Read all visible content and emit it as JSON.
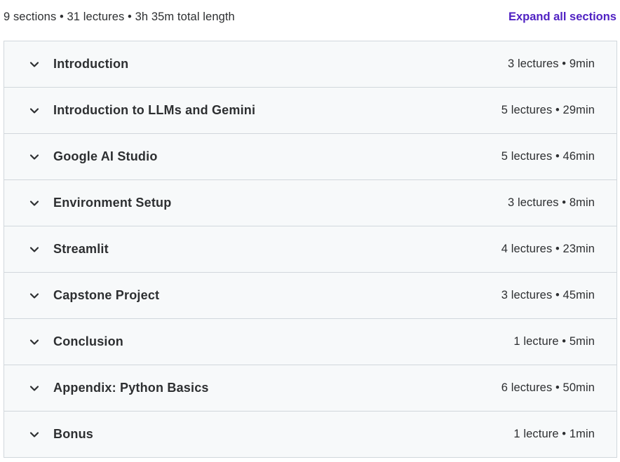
{
  "summary": {
    "text": "9 sections • 31 lectures • 3h 35m total length",
    "expand_label": "Expand all sections"
  },
  "sections": [
    {
      "title": "Introduction",
      "meta": "3 lectures • 9min"
    },
    {
      "title": "Introduction to LLMs and Gemini",
      "meta": "5 lectures • 29min"
    },
    {
      "title": "Google AI Studio",
      "meta": "5 lectures • 46min"
    },
    {
      "title": "Environment Setup",
      "meta": "3 lectures • 8min"
    },
    {
      "title": "Streamlit",
      "meta": "4 lectures • 23min"
    },
    {
      "title": "Capstone Project",
      "meta": "3 lectures • 45min"
    },
    {
      "title": "Conclusion",
      "meta": "1 lecture • 5min"
    },
    {
      "title": "Appendix: Python Basics",
      "meta": "6 lectures • 50min"
    },
    {
      "title": "Bonus",
      "meta": "1 lecture • 1min"
    }
  ],
  "icons": {
    "section_toggle": "chevron-down-icon"
  },
  "colors": {
    "accent": "#5022c3",
    "text": "#2d2f31",
    "row_background": "#f7f9fa",
    "border": "#d1d7dc"
  }
}
